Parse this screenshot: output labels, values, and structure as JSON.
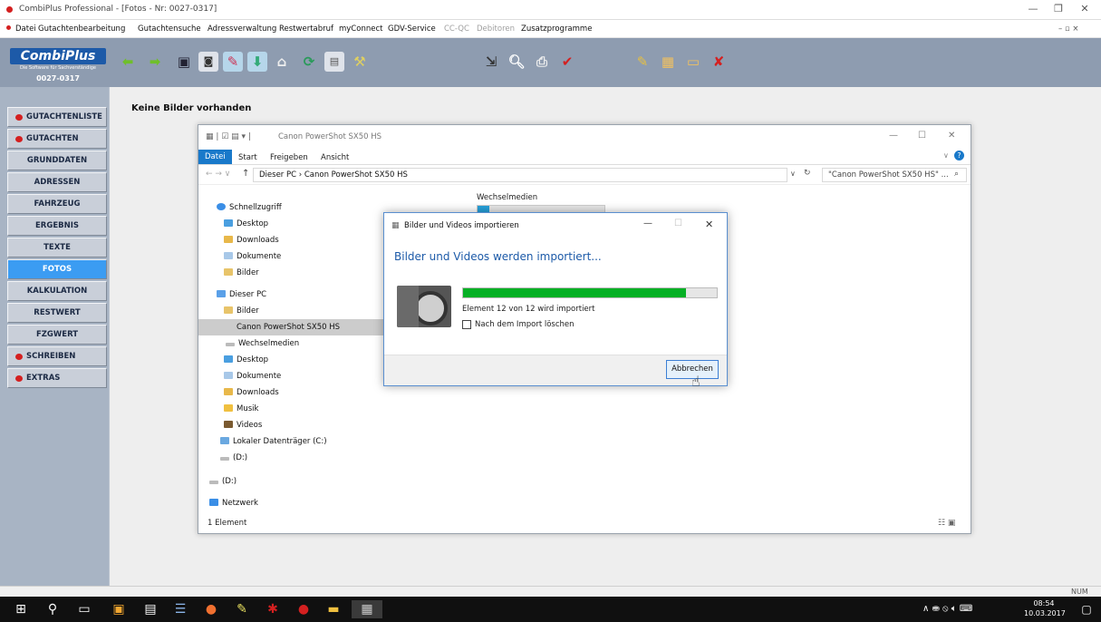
{
  "window": {
    "title": "CombiPlus Professional - [Fotos - Nr: 0027-0317]"
  },
  "menu": [
    "Datei",
    "Gutachtenbearbeitung",
    "Gutachtensuche",
    "Adressverwaltung",
    "Restwertabruf",
    "myConnect",
    "GDV-Service",
    "CC-QC",
    "Debitoren",
    "Zusatzprogramme"
  ],
  "menu_disabled": [
    "CC-QC",
    "Debitoren"
  ],
  "logo": {
    "name": "CombiPlus",
    "tagline": "Die Software für Sachverständige",
    "number": "0027-0317"
  },
  "sidebar": [
    {
      "label": "GUTACHTENLISTE",
      "icon": "red-dot"
    },
    {
      "label": "GUTACHTEN",
      "icon": "red-dot"
    },
    {
      "label": "GRUNDDATEN"
    },
    {
      "label": "ADRESSEN"
    },
    {
      "label": "FAHRZEUG"
    },
    {
      "label": "ERGEBNIS"
    },
    {
      "label": "TEXTE"
    },
    {
      "label": "FOTOS",
      "active": true
    },
    {
      "label": "KALKULATION"
    },
    {
      "label": "RESTWERT"
    },
    {
      "label": "FZGWERT"
    },
    {
      "label": "SCHREIBEN",
      "icon": "red-dot"
    },
    {
      "label": "EXTRAS",
      "icon": "red-dot"
    }
  ],
  "content": {
    "no_pictures": "Keine Bilder vorhanden"
  },
  "explorer": {
    "title": "Canon PowerShot SX50 HS",
    "tabs": [
      "Datei",
      "Start",
      "Freigeben",
      "Ansicht"
    ],
    "address": "Dieser PC  ›  Canon PowerShot SX50 HS",
    "search": "\"Canon PowerShot SX50 HS\" ...",
    "group_label": "Wechselmedien",
    "nav": [
      {
        "label": "Schnellzugriff",
        "icon": "star-icon"
      },
      {
        "label": "Desktop",
        "icon": "folder-icon"
      },
      {
        "label": "Downloads",
        "icon": "download-icon"
      },
      {
        "label": "Dokumente",
        "icon": "document-icon"
      },
      {
        "label": "Bilder",
        "icon": "pictures-icon"
      },
      {
        "label": "Dieser PC",
        "icon": "pc-icon"
      },
      {
        "label": "Bilder",
        "icon": "pictures-icon"
      },
      {
        "label": "Canon PowerShot SX50 HS",
        "icon": "none",
        "selected": true
      },
      {
        "label": "Wechselmedien",
        "icon": "drive-icon"
      },
      {
        "label": "Desktop",
        "icon": "folder-icon"
      },
      {
        "label": "Dokumente",
        "icon": "document-icon"
      },
      {
        "label": "Downloads",
        "icon": "download-icon"
      },
      {
        "label": "Musik",
        "icon": "music-icon"
      },
      {
        "label": "Videos",
        "icon": "video-icon"
      },
      {
        "label": "Lokaler Datenträger (C:)",
        "icon": "disk-icon"
      },
      {
        "label": "(D:)",
        "icon": "drive-icon"
      },
      {
        "label": "(D:)",
        "icon": "drive-icon"
      },
      {
        "label": "Netzwerk",
        "icon": "network-icon"
      }
    ],
    "status": "1 Element"
  },
  "dialog": {
    "title": "Bilder und Videos importieren",
    "heading": "Bilder und Videos werden importiert...",
    "progress": 0.88,
    "status": "Element 12 von 12 wird importiert",
    "checkbox": "Nach dem Import löschen",
    "checkbox_checked": false,
    "cancel": "Abbrechen"
  },
  "statusbar": {
    "num": "NUM"
  },
  "taskbar": {
    "time": "08:54",
    "date": "10.03.2017"
  },
  "colors": {
    "toolbar": "#8e9cb0",
    "sidebar": "#a8b4c4",
    "active": "#3b9cf2",
    "progress": "#06b025",
    "accent": "#1979ca"
  }
}
